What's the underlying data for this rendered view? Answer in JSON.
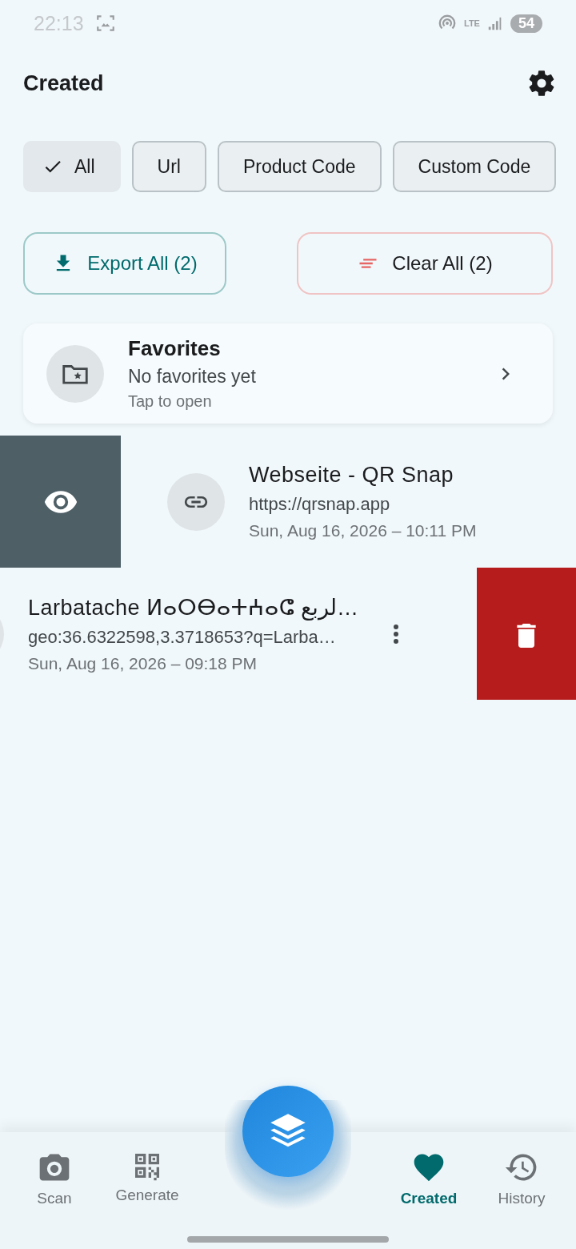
{
  "status_bar": {
    "time": "22:13",
    "battery": "54",
    "network": "LTE"
  },
  "header": {
    "title": "Created"
  },
  "filters": [
    {
      "label": "All",
      "selected": true
    },
    {
      "label": "Url",
      "selected": false
    },
    {
      "label": "Product Code",
      "selected": false
    },
    {
      "label": "Custom Code",
      "selected": false
    }
  ],
  "actions": [
    {
      "kind": "export",
      "label": "Export All (2)"
    },
    {
      "kind": "clear",
      "label": "Clear All (2)"
    }
  ],
  "favorites": {
    "title": "Favorites",
    "subtitle": "No favorites yet",
    "hint": "Tap to open"
  },
  "items": [
    {
      "kind": "link",
      "revealed_action": {
        "kind": "view"
      },
      "title": "Webseite - QR Snap",
      "content": "https://qrsnap.app",
      "date": "Sun, Aug 16, 2026 – 10:11 PM"
    },
    {
      "kind": "geo",
      "revealed_action": {
        "kind": "delete"
      },
      "title": "Larbatache ⵍⴰⵔⴱⴰⵜⵄⴰⵛ لربع…",
      "content": "geo:36.6322598,3.3718653?q=Larba…",
      "date": "Sun, Aug 16, 2026 – 09:18 PM"
    }
  ],
  "nav": [
    {
      "kind": "scan",
      "label": "Scan",
      "selected": false
    },
    {
      "kind": "generate",
      "label": "Generate",
      "selected": false
    },
    {
      "kind": "created",
      "label": "Created",
      "selected": true
    },
    {
      "kind": "history",
      "label": "History",
      "selected": false
    }
  ]
}
